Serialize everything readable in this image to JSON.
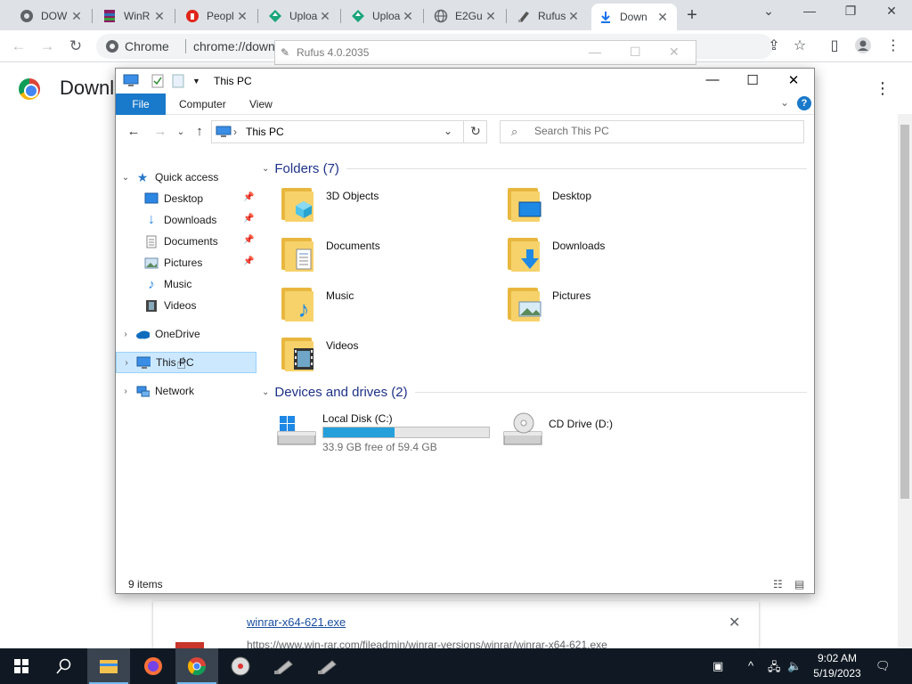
{
  "browser": {
    "tabs": [
      {
        "title": "DOW",
        "icon": "google-drive-icon"
      },
      {
        "title": "WinR",
        "icon": "winrar-icon"
      },
      {
        "title": "Peopl",
        "icon": "people-icon"
      },
      {
        "title": "Uploa",
        "icon": "upload-icon"
      },
      {
        "title": "Uploa",
        "icon": "upload-icon"
      },
      {
        "title": "E2Gu",
        "icon": "globe-icon"
      },
      {
        "title": "Rufus",
        "icon": "rufus-icon"
      },
      {
        "title": "Down",
        "icon": "download-icon"
      }
    ],
    "site_label": "Chrome",
    "url": "chrome://downl",
    "page_title": "Downl"
  },
  "rufus_window": {
    "title": "Rufus 4.0.2035"
  },
  "download_item": {
    "filename": "winrar-x64-621.exe",
    "source_url": "https://www.win-rar.com/fileadmin/winrar-versions/winrar/winrar-x64-621.exe"
  },
  "explorer": {
    "title": "This PC",
    "ribbon_tabs": [
      "File",
      "Computer",
      "View"
    ],
    "address": "This PC",
    "search_placeholder": "Search This PC",
    "nav": {
      "quick_access": "Quick access",
      "pinned": [
        "Desktop",
        "Downloads",
        "Documents",
        "Pictures"
      ],
      "unpinned": [
        "Music",
        "Videos"
      ],
      "onedrive": "OneDrive",
      "this_pc": "This PC",
      "network": "Network"
    },
    "folders_heading": "Folders (7)",
    "folders": [
      "3D Objects",
      "Desktop",
      "Documents",
      "Downloads",
      "Music",
      "Pictures",
      "Videos"
    ],
    "devices_heading": "Devices and drives (2)",
    "drives": [
      {
        "name": "Local Disk (C:)",
        "free_text": "33.9 GB free of 59.4 GB",
        "used_fraction": 0.43
      },
      {
        "name": "CD Drive (D:)"
      }
    ],
    "status_count": "9 items"
  },
  "taskbar": {
    "time": "9:02 AM",
    "date": "5/19/2023"
  }
}
